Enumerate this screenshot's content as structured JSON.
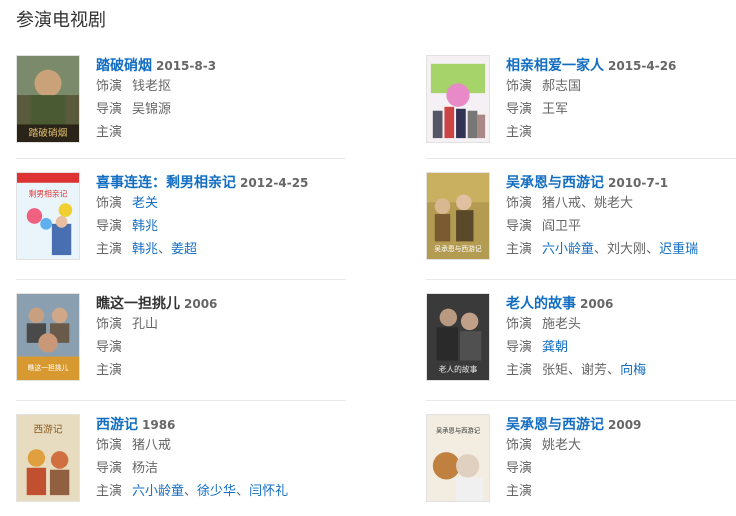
{
  "section_title": "参演电视剧",
  "labels": {
    "role": "饰演",
    "director": "导演",
    "cast": "主演"
  },
  "dramas": [
    {
      "title": "踏破硝烟",
      "date": "2015-8-3",
      "role": "钱老抠",
      "director": [
        "吴锦源"
      ],
      "cast": []
    },
    {
      "title": "相亲相爱一家人",
      "date": "2015-4-26",
      "role": "郝志国",
      "director": [
        "王军"
      ],
      "cast": []
    },
    {
      "title": "喜事连连：剩男相亲记",
      "date": "2012-4-25",
      "role": "老关",
      "director": [
        "韩兆"
      ],
      "cast": [
        "韩兆",
        "姜超"
      ]
    },
    {
      "title": "吴承恩与西游记",
      "date": "2010-7-1",
      "role": "猪八戒、姚老大",
      "director": [
        "阎卫平"
      ],
      "cast": [
        "六小龄童",
        "刘大刚",
        "迟重瑞"
      ]
    },
    {
      "title": "瞧这一担挑儿",
      "date": "2006",
      "role": "孔山",
      "director": [],
      "cast": []
    },
    {
      "title": "老人的故事",
      "date": "2006",
      "role": "施老头",
      "director": [
        "龚朝"
      ],
      "cast": [
        "张矩",
        "谢芳",
        "向梅"
      ]
    },
    {
      "title": "西游记",
      "date": "1986",
      "role": "猪八戒",
      "director": [
        "杨洁"
      ],
      "cast": [
        "六小龄童",
        "徐少华",
        "闫怀礼"
      ]
    },
    {
      "title": "吴承恩与西游记",
      "date": "2009",
      "role": "姚老大",
      "director": [],
      "cast": []
    }
  ],
  "separator": "、",
  "poster_texts": {
    "p1": "踏破硝烟",
    "p3": "剩男相亲记",
    "p4": "吴承恩与西游记",
    "p5": "瞧这一担挑儿",
    "p6": "老人的故事",
    "p7": "西游记",
    "p8": "吴承恩与西游记"
  }
}
